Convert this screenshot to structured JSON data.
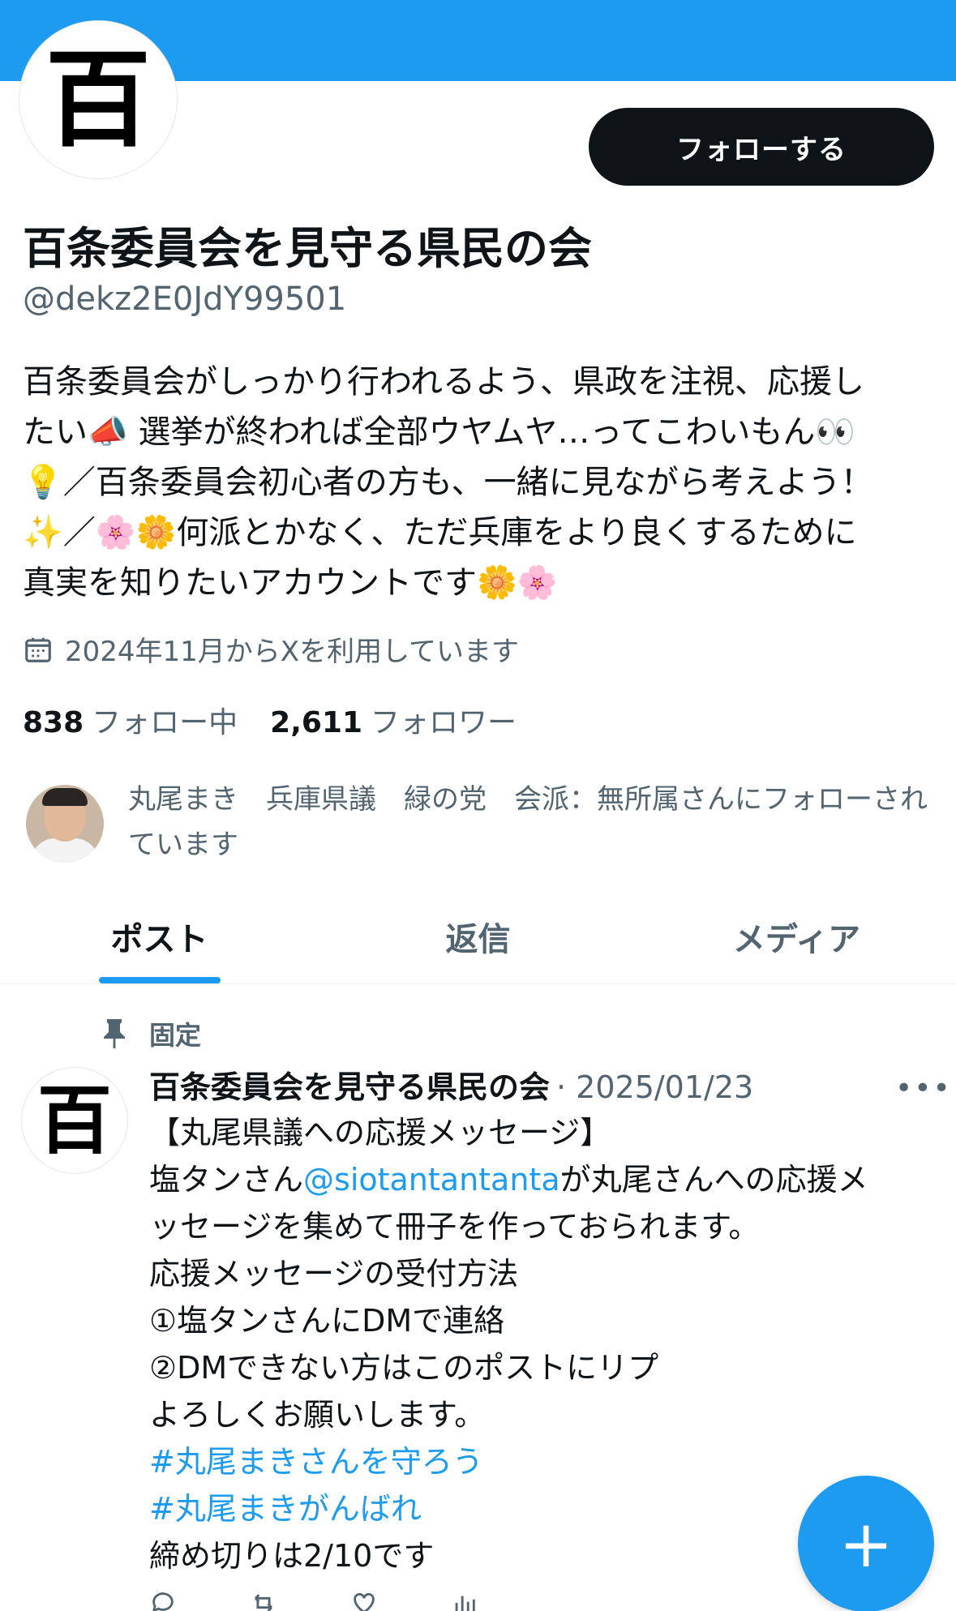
{
  "profile": {
    "avatar_glyph": "百",
    "follow_label": "フォローする",
    "display_name": "百条委員会を見守る県民の会",
    "handle": "@dekz2E0JdY99501",
    "bio_lines": [
      "百条委員会がしっかり行われるよう、県政を注視、応援し",
      "たい📣 選挙が終われば全部ウヤムヤ…ってこわいもん👀",
      "💡／百条委員会初心者の方も、一緒に見ながら考えよう！",
      "✨／🌸🌼何派とかなく、ただ兵庫をより良くするために",
      "真実を知りたいアカウントです🌼🌸"
    ],
    "joined": "2024年11月からXを利用しています",
    "following_count": "838",
    "following_label": "フォロー中",
    "followers_count": "2,611",
    "followers_label": "フォロワー",
    "followed_by_text": "丸尾まき　兵庫県議　緑の党　会派：無所属さんにフォローされています"
  },
  "tabs": [
    {
      "label": "ポスト",
      "active": true
    },
    {
      "label": "返信",
      "active": false
    },
    {
      "label": "メディア",
      "active": false
    }
  ],
  "post": {
    "pinned_label": "固定",
    "avatar_glyph": "百",
    "author": "百条委員会を見守る県民の会",
    "date": "· 2025/01/23",
    "more_glyph": "•••",
    "line1": "【丸尾県議への応援メッセージ】",
    "line2_pre": "塩タンさん",
    "line2_mention": "@siotantantanta",
    "line2_post": "が丸尾さんへの応援メ",
    "line3": "ッセージを集めて冊子を作っておられます。",
    "line4": "応援メッセージの受付方法",
    "line5": "①塩タンさんにDMで連絡",
    "line6": "②DMできない方はこのポストにリプ",
    "line7": "よろしくお願いします。",
    "hashtag1": "#丸尾まきさんを守ろう",
    "hashtag2": "#丸尾まきがんばれ",
    "line10": "締め切りは2/10です"
  },
  "fab": {
    "glyph": "+"
  },
  "colors": {
    "accent": "#1d9bf0",
    "text": "#0f1419",
    "muted": "#536471"
  }
}
